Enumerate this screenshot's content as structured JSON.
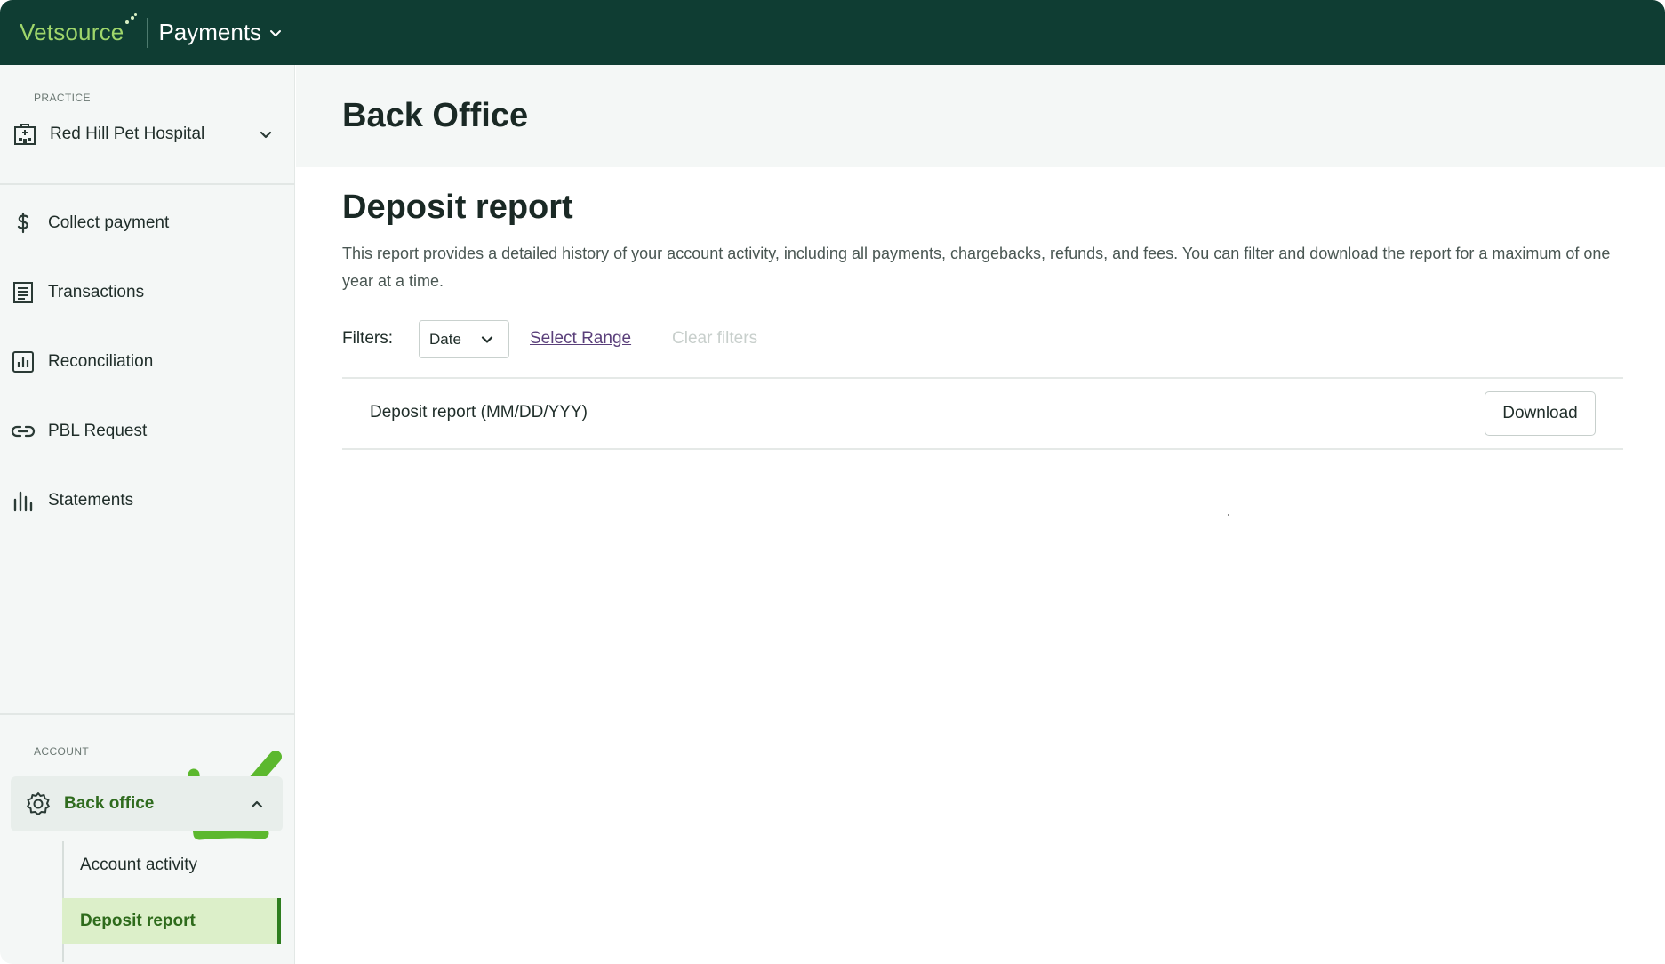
{
  "topbar": {
    "logo_text": "Vetsource",
    "app_name": "Payments",
    "background_color": "#0f3d33",
    "logo_color": "#9fd66b"
  },
  "sidebar": {
    "practice_section_label": "PRACTICE",
    "practice_name": "Red Hill Pet Hospital",
    "nav_items": [
      {
        "label": "Collect payment",
        "icon": "dollar-icon"
      },
      {
        "label": "Transactions",
        "icon": "receipt-icon"
      },
      {
        "label": "Reconciliation",
        "icon": "bar-chart-box-icon"
      },
      {
        "label": "PBL Request",
        "icon": "link-icon"
      },
      {
        "label": "Statements",
        "icon": "bar-chart-icon"
      }
    ],
    "account_section_label": "ACCOUNT",
    "back_office": {
      "label": "Back office",
      "icon": "gear-icon",
      "expanded": true,
      "sub_items": [
        {
          "label": "Account activity",
          "active": false
        },
        {
          "label": "Deposit report",
          "active": true
        }
      ]
    },
    "accent_color": "#2e7d1f"
  },
  "main": {
    "page_title": "Back Office",
    "section_title": "Deposit report",
    "description": "This report provides a detailed history of your account activity, including all payments, chargebacks, refunds, and fees. You can filter and download the report for a maximum of one year at a time.",
    "filters": {
      "label": "Filters:",
      "date_select_value": "Date",
      "select_range_label": "Select Range",
      "clear_filters_label": "Clear filters"
    },
    "report_row": {
      "label": "Deposit report (MM/DD/YYY)",
      "download_label": "Download"
    }
  }
}
